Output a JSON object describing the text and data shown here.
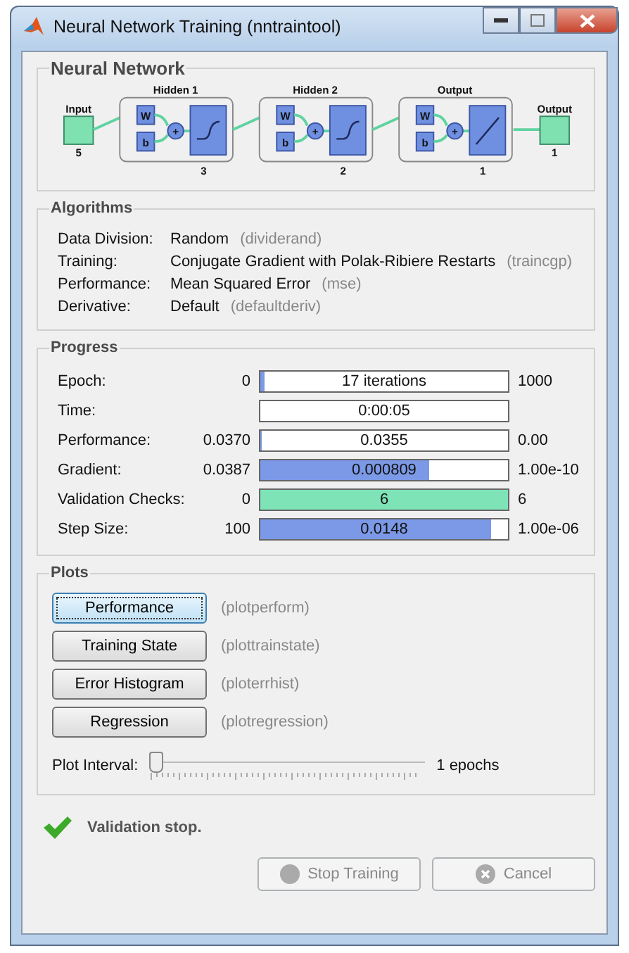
{
  "window": {
    "title": "Neural Network Training (nntraintool)"
  },
  "network": {
    "title": "Neural Network",
    "input": {
      "label": "Input",
      "size": "5"
    },
    "layers": [
      {
        "title": "Hidden 1",
        "size": "3",
        "weight_label": "W",
        "bias_label": "b",
        "sum_symbol": "+",
        "kind": "sigmoid"
      },
      {
        "title": "Hidden 2",
        "size": "2",
        "weight_label": "W",
        "bias_label": "b",
        "sum_symbol": "+",
        "kind": "sigmoid"
      },
      {
        "title": "Output",
        "size": "1",
        "weight_label": "W",
        "bias_label": "b",
        "sum_symbol": "+",
        "kind": "linear"
      }
    ],
    "output": {
      "label": "Output",
      "size": "1"
    }
  },
  "algorithms": {
    "title": "Algorithms",
    "rows": [
      {
        "label": "Data Division:",
        "value": "Random",
        "function": "(dividerand)"
      },
      {
        "label": "Training:",
        "value": "Conjugate Gradient with Polak-Ribiere Restarts",
        "function": "(traincgp)"
      },
      {
        "label": "Performance:",
        "value": "Mean Squared Error",
        "function": "(mse)"
      },
      {
        "label": "Derivative:",
        "value": "Default",
        "function": "(defaultderiv)"
      }
    ]
  },
  "progress": {
    "title": "Progress",
    "rows": [
      {
        "label": "Epoch:",
        "start": "0",
        "reading": "17 iterations",
        "level": 0.015,
        "end": "1000",
        "kind": "measure"
      },
      {
        "label": "Time:",
        "reading": "0:00:05",
        "level": 0,
        "kind": "measure"
      },
      {
        "label": "Performance:",
        "start": "0.0370",
        "reading": "0.0355",
        "level": 0.008,
        "end": "0.00",
        "kind": "measure"
      },
      {
        "label": "Gradient:",
        "start": "0.0387",
        "reading": "0.000809",
        "level": 0.68,
        "end": "1.00e-10",
        "kind": "measure"
      },
      {
        "label": "Validation Checks:",
        "start": "0",
        "reading": "6",
        "level": 1,
        "end": "6",
        "kind": "check"
      },
      {
        "label": "Step Size:",
        "start": "100",
        "reading": "0.0148",
        "level": 0.93,
        "end": "1.00e-06",
        "kind": "measure"
      }
    ]
  },
  "plots": {
    "title": "Plots",
    "buttons": [
      {
        "label": "Performance",
        "function": "(plotperform)",
        "focused": true
      },
      {
        "label": "Training State",
        "function": "(plottrainstate)",
        "focused": false
      },
      {
        "label": "Error Histogram",
        "function": "(ploterrhist)",
        "focused": false
      },
      {
        "label": "Regression",
        "function": "(plotregression)",
        "focused": false
      }
    ],
    "interval": {
      "label": "Plot Interval:",
      "level": 0,
      "reading": "1 epochs"
    }
  },
  "status": {
    "text": "Validation stop."
  },
  "buttons": [
    {
      "label": "Stop Training",
      "kind": "stop",
      "disabled": true
    },
    {
      "label": "Cancel",
      "kind": "cancel",
      "disabled": true
    }
  ]
}
